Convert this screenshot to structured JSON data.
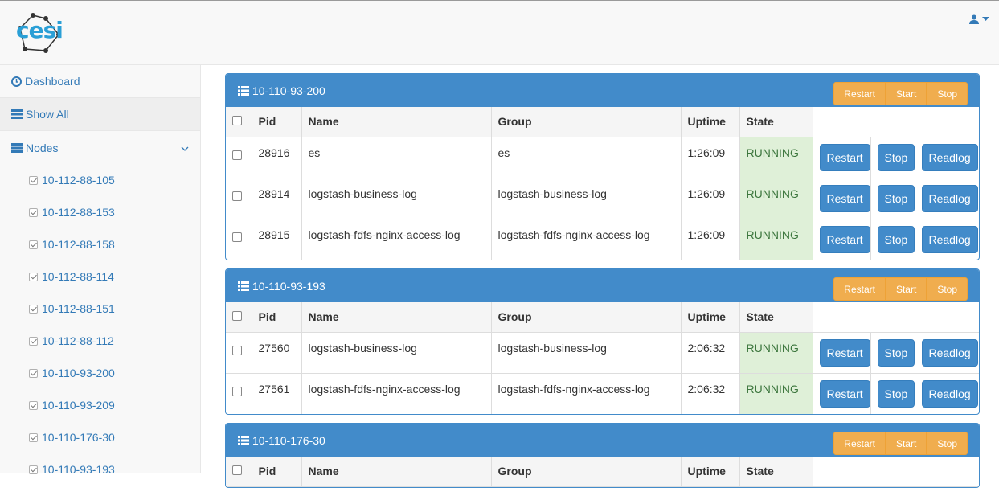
{
  "logo": {
    "text": "cesi"
  },
  "user_menu": {
    "icon": "user-icon",
    "caret": "caret-down-icon"
  },
  "sidebar": {
    "dashboard": "Dashboard",
    "show_all": "Show All",
    "nodes": "Nodes",
    "node_items": [
      "10-112-88-105",
      "10-112-88-153",
      "10-112-88-158",
      "10-112-88-114",
      "10-112-88-151",
      "10-112-88-112",
      "10-110-93-200",
      "10-110-93-209",
      "10-110-176-30",
      "10-110-93-193"
    ]
  },
  "group_buttons": {
    "restart": "Restart",
    "start": "Start",
    "stop": "Stop"
  },
  "columns": {
    "pid": "Pid",
    "name": "Name",
    "group": "Group",
    "uptime": "Uptime",
    "state": "State"
  },
  "row_buttons": {
    "restart": "Restart",
    "stop": "Stop",
    "readlog": "Readlog"
  },
  "panels": [
    {
      "title": "10-110-93-200",
      "rows": [
        {
          "pid": "28916",
          "name": "es",
          "group": "es",
          "uptime": "1:26:09",
          "state": "RUNNING"
        },
        {
          "pid": "28914",
          "name": "logstash-business-log",
          "group": "logstash-business-log",
          "uptime": "1:26:09",
          "state": "RUNNING"
        },
        {
          "pid": "28915",
          "name": "logstash-fdfs-nginx-access-log",
          "group": "logstash-fdfs-nginx-access-log",
          "uptime": "1:26:09",
          "state": "RUNNING"
        }
      ]
    },
    {
      "title": "10-110-93-193",
      "rows": [
        {
          "pid": "27560",
          "name": "logstash-business-log",
          "group": "logstash-business-log",
          "uptime": "2:06:32",
          "state": "RUNNING"
        },
        {
          "pid": "27561",
          "name": "logstash-fdfs-nginx-access-log",
          "group": "logstash-fdfs-nginx-access-log",
          "uptime": "2:06:32",
          "state": "RUNNING"
        }
      ]
    },
    {
      "title": "10-110-176-30",
      "rows": []
    }
  ],
  "colors": {
    "primary": "#428bca",
    "warning": "#f0ad4e",
    "success_bg": "#dff0d8",
    "success_text": "#3c763d"
  }
}
